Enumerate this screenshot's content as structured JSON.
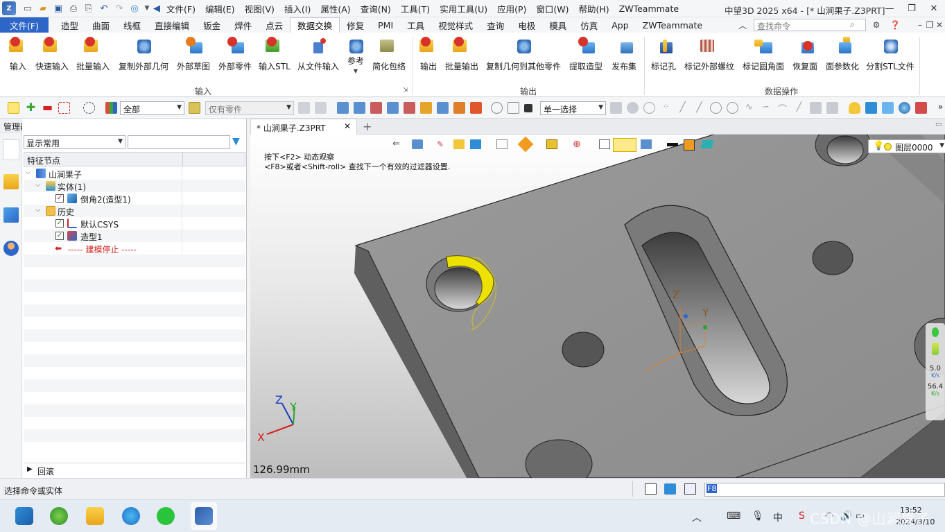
{
  "titlebar": {
    "menus": [
      "文件(F)",
      "编辑(E)",
      "视图(V)",
      "插入(I)",
      "属性(A)",
      "查询(N)",
      "工具(T)",
      "实用工具(U)",
      "应用(P)",
      "窗口(W)",
      "帮助(H)",
      "ZWTeammate"
    ],
    "window_title": "中望3D 2025 x64 - [* 山涧果子.Z3PRT]"
  },
  "ribbon_tabs": [
    "文件(F)",
    "造型",
    "曲面",
    "线框",
    "直接编辑",
    "钣金",
    "焊件",
    "点云",
    "数据交换",
    "修复",
    "PMI",
    "工具",
    "视觉样式",
    "查询",
    "电极",
    "模具",
    "仿真",
    "App",
    "ZWTeammate"
  ],
  "active_tab": "数据交换",
  "search": {
    "placeholder": "查找命令"
  },
  "ribbon": {
    "input_group": {
      "label": "输入",
      "buttons": [
        "输入",
        "快速输入",
        "批量输入",
        "复制外部几何",
        "外部草图",
        "外部零件",
        "输入STL",
        "从文件输入",
        "参考",
        "简化包络"
      ]
    },
    "output_group": {
      "label": "输出",
      "buttons": [
        "输出",
        "批量输出",
        "复制几何到其他零件",
        "提取造型",
        "发布集"
      ]
    },
    "data_ops_group": {
      "label": "数据操作",
      "buttons": [
        "标记孔",
        "标记外部螺纹",
        "标记圆角面",
        "恢复面",
        "面参数化",
        "分割STL文件"
      ]
    }
  },
  "toolbar2": {
    "filter_value": "全部",
    "part_filter_value": "仅有零件",
    "select_mode_value": "单一选择"
  },
  "manager": {
    "title": "管理器",
    "display_value": "显示常用",
    "column_header": "特征节点",
    "tree": [
      {
        "label": "山涧果子"
      },
      {
        "label": "实体(1)"
      },
      {
        "label": "倒角2(造型1)"
      },
      {
        "label": "历史"
      },
      {
        "label": "默认CSYS"
      },
      {
        "label": "造型1"
      },
      {
        "label": "----- 建模停止 -----"
      }
    ],
    "rollback_label": "回滚"
  },
  "document": {
    "tab_label": "* 山涧果子.Z3PRT",
    "hint_line1": "按下<F2> 动态观察",
    "hint_line2": "<F8>或者<Shift-roll> 查找下一个有效的过滤器设置.",
    "scale_label": "126.99mm",
    "layer_value": "图层0000",
    "axes": {
      "x": "X",
      "y": "Y",
      "z": "Z"
    }
  },
  "net_widget": {
    "upload": "5.0",
    "upload_unit": "K/s",
    "download": "56.4",
    "download_unit": "K/s"
  },
  "statusbar": {
    "status_text": "选择命令或实体",
    "command_value": "F8"
  },
  "taskbar": {
    "time": "13:52",
    "date": "2024/3/10",
    "watermark": "CSDN @山涧果子"
  },
  "colors": {
    "accent": "#2e66c8",
    "model_gray": "#8a8a8a",
    "highlight_yellow": "#e8e000",
    "checkbox_green": "#1d8a1d",
    "stop_red": "#d42020"
  }
}
